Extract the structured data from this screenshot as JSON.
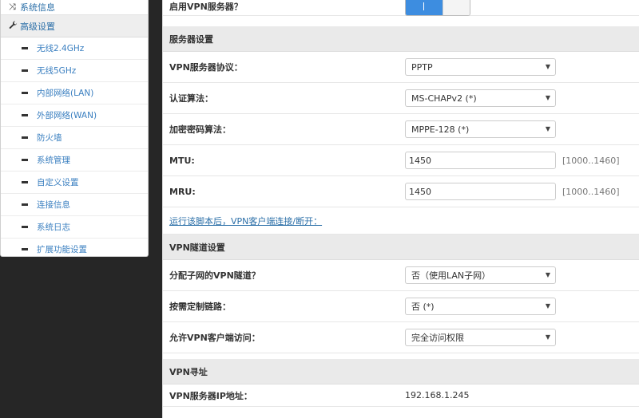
{
  "sidebar": {
    "top_item": {
      "label": "系统信息",
      "icon": "shuffle-icon"
    },
    "section": {
      "label": "高级设置",
      "icon": "wrench-icon"
    },
    "items": [
      {
        "label": "无线2.4GHz"
      },
      {
        "label": "无线5GHz"
      },
      {
        "label": "内部网络(LAN)"
      },
      {
        "label": "外部网络(WAN)"
      },
      {
        "label": "防火墙"
      },
      {
        "label": "系统管理"
      },
      {
        "label": "自定义设置"
      },
      {
        "label": "连接信息"
      },
      {
        "label": "系统日志"
      },
      {
        "label": "扩展功能设置"
      }
    ]
  },
  "main": {
    "enable_vpn": {
      "label": "启用VPN服务器？",
      "state": "on"
    },
    "server_section": {
      "title": "服务器设置"
    },
    "protocol": {
      "label": "VPN服务器协议：",
      "value": "PPTP"
    },
    "auth": {
      "label": "认证算法：",
      "value": "MS-CHAPv2 (*)"
    },
    "encryption": {
      "label": "加密密码算法：",
      "value": "MPPE-128 (*)"
    },
    "mtu": {
      "label": "MTU:",
      "value": "1450",
      "range": "[1000..1460]"
    },
    "mru": {
      "label": "MRU:",
      "value": "1450",
      "range": "[1000..1460]"
    },
    "script_link": "运行该脚本后，VPN客户端连接/断开：",
    "tunnel_section": {
      "title": "VPN隧道设置"
    },
    "subnet_tunnel": {
      "label": "分配子网的VPN隧道？",
      "value": "否（使用LAN子网）"
    },
    "on_demand": {
      "label": "按需定制链路：",
      "value": "否 (*)"
    },
    "client_access": {
      "label": "允许VPN客户端访问：",
      "value": "完全访问权限"
    },
    "addr_section": {
      "title": "VPN寻址"
    },
    "server_ip": {
      "label": "VPN服务器IP地址：",
      "value": "192.168.1.245"
    }
  },
  "colors": {
    "accent": "#3d8de0",
    "link": "#2b6fa8",
    "background": "#262626",
    "section": "#eaeaea"
  }
}
